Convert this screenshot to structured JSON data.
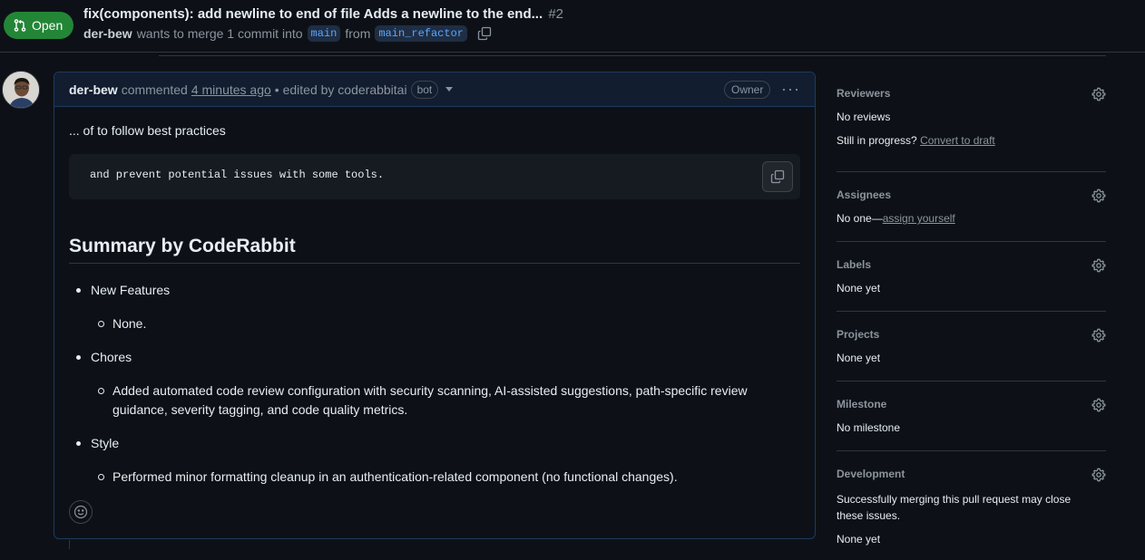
{
  "header": {
    "status": "Open",
    "title": "fix(components): add newline to end of file Adds a newline to the end...",
    "number": "#2",
    "author": "der-bew",
    "merge_text": "wants to merge 1 commit into",
    "base_branch": "main",
    "from_text": "from",
    "head_branch": "main_refactor"
  },
  "comment": {
    "author": "der-bew",
    "action": "commented",
    "time": "4 minutes ago",
    "edited_text": "• edited by coderabbitai",
    "bot_badge": "bot",
    "owner_badge": "Owner",
    "intro": "... of to follow best practices",
    "code": "and prevent potential issues with some tools.",
    "summary_heading": "Summary by CodeRabbit",
    "items": [
      {
        "label": "New Features",
        "subitems": [
          "None."
        ]
      },
      {
        "label": "Chores",
        "subitems": [
          "Added automated code review configuration with security scanning, AI-assisted suggestions, path-specific review guidance, severity tagging, and code quality metrics."
        ]
      },
      {
        "label": "Style",
        "subitems": [
          "Performed minor formatting cleanup in an authentication-related component (no functional changes)."
        ]
      }
    ]
  },
  "sidebar": {
    "reviewers": {
      "title": "Reviewers",
      "value": "No reviews",
      "progress_text": "Still in progress?",
      "convert_link": "Convert to draft"
    },
    "assignees": {
      "title": "Assignees",
      "value": "No one—",
      "assign_link": "assign yourself"
    },
    "labels": {
      "title": "Labels",
      "value": "None yet"
    },
    "projects": {
      "title": "Projects",
      "value": "None yet"
    },
    "milestone": {
      "title": "Milestone",
      "value": "No milestone"
    },
    "development": {
      "title": "Development",
      "description": "Successfully merging this pull request may close these issues.",
      "value": "None yet"
    }
  },
  "colors": {
    "open_green": "#238636",
    "background": "#0d1117",
    "link_blue": "#58a6ff"
  }
}
